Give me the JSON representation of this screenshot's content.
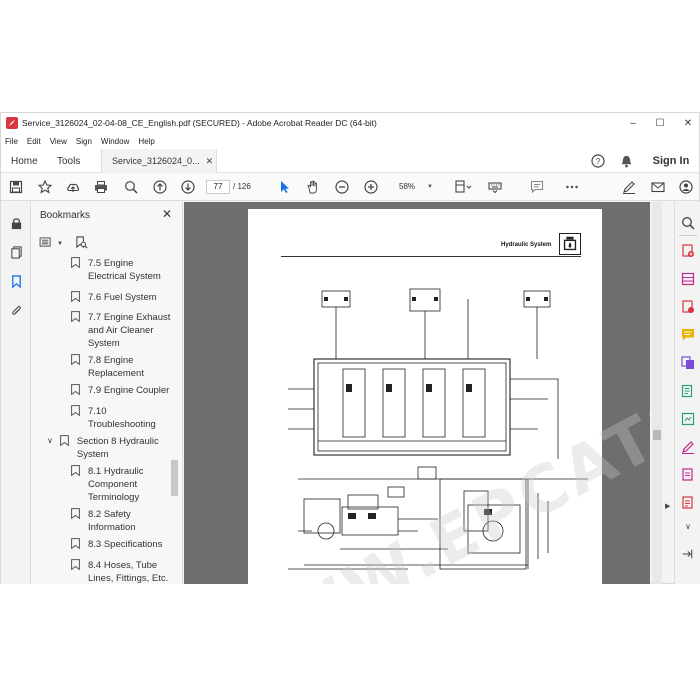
{
  "window": {
    "title": "Service_3126024_02-04-08_CE_English.pdf (SECURED) - Adobe Acrobat Reader DC (64-bit)",
    "controls": {
      "minimize": "–",
      "maximize": "☐",
      "close": "✕"
    }
  },
  "menu": [
    "File",
    "Edit",
    "View",
    "Sign",
    "Window",
    "Help"
  ],
  "tabs": {
    "home": "Home",
    "tools": "Tools",
    "document": "Service_3126024_0...",
    "close": "✕",
    "sign_in": "Sign In"
  },
  "toolbar": {
    "current_page": "77",
    "page_total": "/ 126",
    "zoom": "58%"
  },
  "bookmarks": {
    "header": "Bookmarks",
    "close": "✕",
    "items": [
      {
        "label_lines": [
          "7.5 Engine",
          "Electrical System"
        ],
        "indent": 2
      },
      {
        "label_lines": [
          "7.6 Fuel System"
        ],
        "indent": 2
      },
      {
        "label_lines": [
          "7.7 Engine Exhaust",
          "and Air Cleaner",
          "System"
        ],
        "indent": 2
      },
      {
        "label_lines": [
          "7.8 Engine",
          "Replacement"
        ],
        "indent": 2
      },
      {
        "label_lines": [
          "7.9 Engine Coupler"
        ],
        "indent": 2
      },
      {
        "label_lines": [
          "7.10",
          "Troubleshooting"
        ],
        "indent": 2
      },
      {
        "label_lines": [
          "Section 8 Hydraulic",
          "System"
        ],
        "indent": 1,
        "expanded": true
      },
      {
        "label_lines": [
          "8.1 Hydraulic",
          "Component",
          "Terminology"
        ],
        "indent": 2
      },
      {
        "label_lines": [
          "8.2 Safety",
          "Information"
        ],
        "indent": 2
      },
      {
        "label_lines": [
          "8.3 Specifications"
        ],
        "indent": 2
      },
      {
        "label_lines": [
          "8.4 Hoses, Tube",
          "Lines, Fittings, Etc."
        ],
        "indent": 2
      }
    ]
  },
  "page": {
    "header_title": "Hydraulic System",
    "watermark": "WWW.EPCATS.COM"
  },
  "colors": {
    "accent_blue": "#1473e6",
    "pdf_red": "#d7373f",
    "rail_green": "#2d9d78",
    "rail_purple": "#7b4dd6",
    "rail_pink": "#c4268f",
    "rail_yellow": "#e6b400"
  }
}
